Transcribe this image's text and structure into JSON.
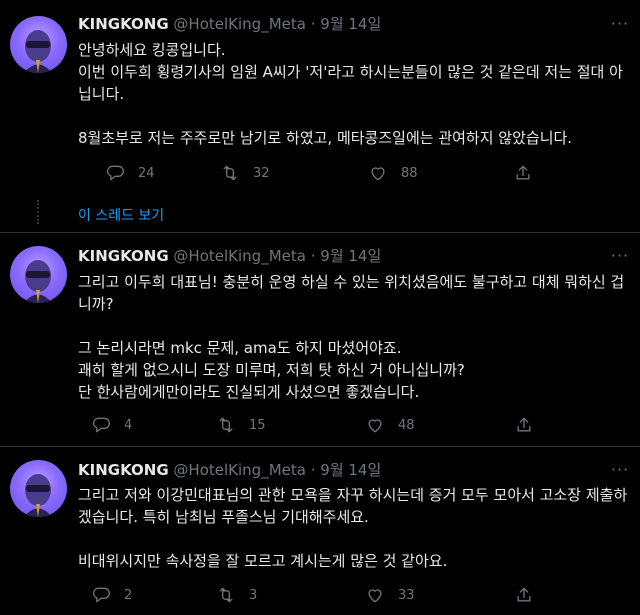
{
  "tweets": [
    {
      "name": "KINGKONG",
      "handle": "@HotelKing_Meta",
      "separator": "·",
      "date": "9월 14일",
      "text": "안녕하세요 킹콩입니다.\n이번 이두희 횡령기사의 임원 A씨가 '저'라고 하시는분들이 많은 것 같은데 저는 절대 아닙니다.\n\n8월초부로 저는 주주로만 남기로 하였고, 메타콩즈일에는 관여하지 않았습니다.",
      "replies": "24",
      "retweets": "32",
      "likes": "88"
    },
    {
      "name": "KINGKONG",
      "handle": "@HotelKing_Meta",
      "separator": "·",
      "date": "9월 14일",
      "text": "그리고 이두희 대표님! 충분히 운영 하실 수 있는 위치셨음에도 불구하고 대체 뭐하신 겁니까?\n\n그 논리시라면 mkc 문제, ama도 하지 마셨어야죠.\n괘히 할게 없으시니 도장 미루며, 저희 탓 하신 거 아니십니까?\n단 한사람에게만이라도 진실되게 사셨으면 좋겠습니다.",
      "replies": "4",
      "retweets": "15",
      "likes": "48"
    },
    {
      "name": "KINGKONG",
      "handle": "@HotelKing_Meta",
      "separator": "·",
      "date": "9월 14일",
      "text": "그리고 저와 이강민대표님의 관한 모욕을 자꾸 하시는데 증거 모두 모아서 고소장 제출하겠습니다. 특히 남최님 푸졸스님 기대해주세요.\n\n비대위시지만 속사정을 잘 모르고 계시는게 많은 것 같아요.",
      "replies": "2",
      "retweets": "3",
      "likes": "33"
    }
  ],
  "thread": {
    "show_thread_label": "이 스레드 보기"
  },
  "colors": {
    "accent": "#1d9bf0",
    "muted": "#71767b",
    "text": "#e7e9ea",
    "background": "#000000"
  },
  "icons": [
    "reply-icon",
    "retweet-icon",
    "like-icon",
    "share-icon",
    "more-icon"
  ]
}
